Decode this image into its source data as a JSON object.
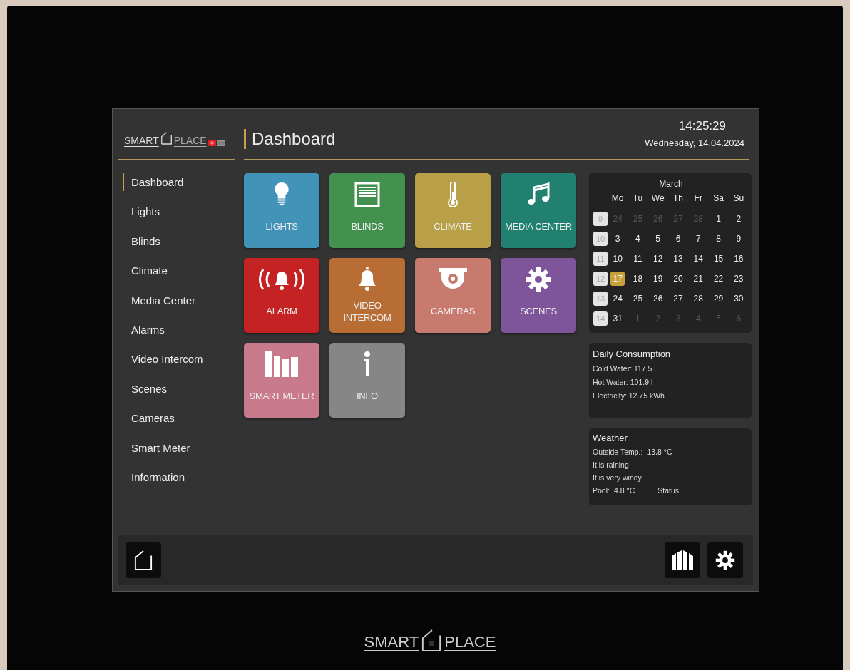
{
  "header": {
    "logo": {
      "left": "SMART",
      "right": "PLACE"
    },
    "title": "Dashboard",
    "time": "14:25:29",
    "date": "Wednesday, 14.04.2024"
  },
  "sidebar": {
    "items": [
      {
        "label": "Dashboard",
        "selected": true
      },
      {
        "label": "Lights",
        "selected": false
      },
      {
        "label": "Blinds",
        "selected": false
      },
      {
        "label": "Climate",
        "selected": false
      },
      {
        "label": "Media Center",
        "selected": false
      },
      {
        "label": "Alarms",
        "selected": false
      },
      {
        "label": "Video Intercom",
        "selected": false
      },
      {
        "label": "Scenes",
        "selected": false
      },
      {
        "label": "Cameras",
        "selected": false
      },
      {
        "label": "Smart Meter",
        "selected": false
      },
      {
        "label": "Information",
        "selected": false
      }
    ]
  },
  "tiles": [
    {
      "label": "LIGHTS",
      "kind": "bulb",
      "color": "#4193b8"
    },
    {
      "label": "BLINDS",
      "kind": "blinds",
      "color": "#43914f"
    },
    {
      "label": "CLIMATE",
      "kind": "thermometer",
      "color": "#b9a048"
    },
    {
      "label": "MEDIA CENTER",
      "kind": "music",
      "color": "#21806f"
    },
    {
      "label": "ALARM",
      "kind": "alarm",
      "color": "#c52223"
    },
    {
      "label": "VIDEO INTERCOM",
      "kind": "bell",
      "color": "#b86d34"
    },
    {
      "label": "CAMERAS",
      "kind": "camera",
      "color": "#c97a6e"
    },
    {
      "label": "SCENES",
      "kind": "gear",
      "color": "#7e559a"
    },
    {
      "label": "SMART METER",
      "kind": "bars",
      "color": "#c9798c"
    },
    {
      "label": "INFO",
      "kind": "info",
      "color": "#868686"
    }
  ],
  "calendar": {
    "month": "March",
    "weekdays": [
      "Mo",
      "Tu",
      "We",
      "Th",
      "Fr",
      "Sa",
      "Su"
    ],
    "weeks": [
      {
        "number": "9",
        "days": [
          {
            "d": "24",
            "muted": true,
            "selected": false
          },
          {
            "d": "25",
            "muted": true,
            "selected": false
          },
          {
            "d": "26",
            "muted": true,
            "selected": false
          },
          {
            "d": "27",
            "muted": true,
            "selected": false
          },
          {
            "d": "28",
            "muted": true,
            "selected": false
          },
          {
            "d": "1",
            "muted": false,
            "selected": false
          },
          {
            "d": "2",
            "muted": false,
            "selected": false
          }
        ]
      },
      {
        "number": "10",
        "days": [
          {
            "d": "3",
            "muted": false,
            "selected": false
          },
          {
            "d": "4",
            "muted": false,
            "selected": false
          },
          {
            "d": "5",
            "muted": false,
            "selected": false
          },
          {
            "d": "6",
            "muted": false,
            "selected": false
          },
          {
            "d": "7",
            "muted": false,
            "selected": false
          },
          {
            "d": "8",
            "muted": false,
            "selected": false
          },
          {
            "d": "9",
            "muted": false,
            "selected": false
          }
        ]
      },
      {
        "number": "11",
        "days": [
          {
            "d": "10",
            "muted": false,
            "selected": false
          },
          {
            "d": "11",
            "muted": false,
            "selected": false
          },
          {
            "d": "12",
            "muted": false,
            "selected": false
          },
          {
            "d": "13",
            "muted": false,
            "selected": false
          },
          {
            "d": "14",
            "muted": false,
            "selected": false
          },
          {
            "d": "15",
            "muted": false,
            "selected": false
          },
          {
            "d": "16",
            "muted": false,
            "selected": false
          }
        ]
      },
      {
        "number": "12",
        "days": [
          {
            "d": "17",
            "muted": false,
            "selected": true
          },
          {
            "d": "18",
            "muted": false,
            "selected": false
          },
          {
            "d": "19",
            "muted": false,
            "selected": false
          },
          {
            "d": "20",
            "muted": false,
            "selected": false
          },
          {
            "d": "21",
            "muted": false,
            "selected": false
          },
          {
            "d": "22",
            "muted": false,
            "selected": false
          },
          {
            "d": "23",
            "muted": false,
            "selected": false
          }
        ]
      },
      {
        "number": "13",
        "days": [
          {
            "d": "24",
            "muted": false,
            "selected": false
          },
          {
            "d": "25",
            "muted": false,
            "selected": false
          },
          {
            "d": "26",
            "muted": false,
            "selected": false
          },
          {
            "d": "27",
            "muted": false,
            "selected": false
          },
          {
            "d": "28",
            "muted": false,
            "selected": false
          },
          {
            "d": "29",
            "muted": false,
            "selected": false
          },
          {
            "d": "30",
            "muted": false,
            "selected": false
          }
        ]
      },
      {
        "number": "14",
        "days": [
          {
            "d": "31",
            "muted": false,
            "selected": false
          },
          {
            "d": "1",
            "muted": true,
            "selected": false
          },
          {
            "d": "2",
            "muted": true,
            "selected": false
          },
          {
            "d": "3",
            "muted": true,
            "selected": false
          },
          {
            "d": "4",
            "muted": true,
            "selected": false
          },
          {
            "d": "5",
            "muted": true,
            "selected": false
          },
          {
            "d": "6",
            "muted": true,
            "selected": false
          }
        ]
      }
    ]
  },
  "consumption": {
    "title": "Daily Consumption",
    "lines": [
      "Cold Water: 117.5 l",
      "Hot Water: 101.9 l",
      "Electricity: 12.75 kWh"
    ]
  },
  "weather": {
    "title": "Weather",
    "temp_label": "Outside Temp.:",
    "temp_value": "13.8 °C",
    "lines": [
      "It is raining",
      "It is very windy"
    ],
    "pool_label": "Pool:",
    "pool_value": "4.8 °C",
    "status_label": "Status:"
  },
  "footer_logo": {
    "left": "SMART",
    "right": "PLACE"
  }
}
